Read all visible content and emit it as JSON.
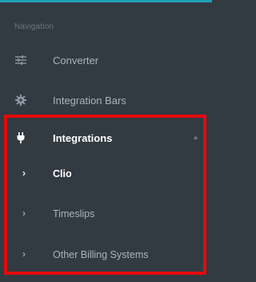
{
  "nav": {
    "section_label": "Navigation",
    "items": [
      {
        "label": "Converter",
        "icon": "sliders-icon"
      },
      {
        "label": "Integration Bars",
        "icon": "gear-icon"
      },
      {
        "label": "Integrations",
        "icon": "plug-icon",
        "expanded": true
      }
    ],
    "sub_items": [
      {
        "label": "Clio",
        "active": true
      },
      {
        "label": "Timeslips",
        "active": false
      },
      {
        "label": "Other Billing Systems",
        "active": false
      }
    ]
  },
  "colors": {
    "background": "#323a42",
    "accent": "#1fa1b5",
    "highlight": "#e30b0b"
  }
}
